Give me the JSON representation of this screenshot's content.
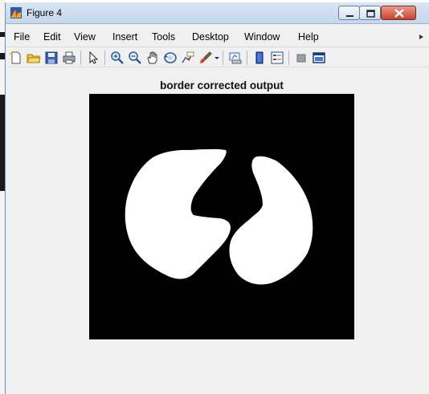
{
  "window": {
    "title": "Figure 4",
    "controls": [
      "minimize",
      "maximize",
      "close"
    ]
  },
  "menu": {
    "items": [
      "File",
      "Edit",
      "View",
      "Insert",
      "Tools",
      "Desktop",
      "Window",
      "Help"
    ],
    "overflow_icon": "chevron-right-icon"
  },
  "toolbar": {
    "icons": [
      "new-figure-icon",
      "open-file-icon",
      "save-icon",
      "print-icon",
      "pointer-icon",
      "zoom-in-icon",
      "zoom-out-icon",
      "pan-hand-icon",
      "rotate-3d-icon",
      "data-cursor-icon",
      "brush-icon",
      "link-plot-icon",
      "colorbar-icon",
      "legend-icon",
      "hide-plot-tools-icon",
      "show-plot-tools-icon"
    ]
  },
  "figure": {
    "title": "border corrected output",
    "image_background": "#000000",
    "foreground": "#ffffff",
    "content": "binary image of two lung-shaped regions"
  },
  "colors": {
    "titlebar": "#c9dcef",
    "close_button": "#c7432b",
    "window_bg": "#f0f0f0"
  }
}
